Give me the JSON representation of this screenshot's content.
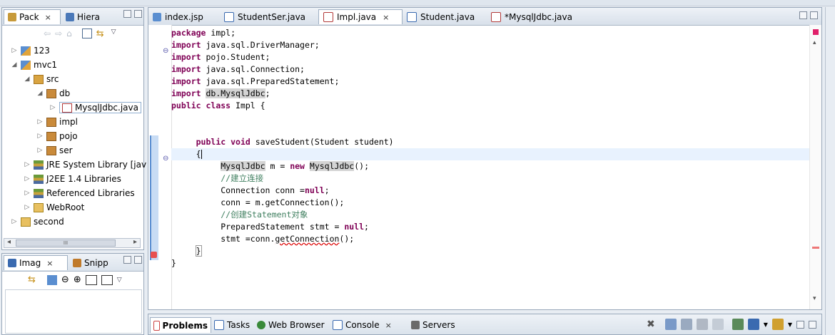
{
  "explorer": {
    "tabs": [
      {
        "label": "Pack",
        "close": "×"
      },
      {
        "label": "Hiera"
      }
    ],
    "tree": [
      {
        "label": "123",
        "twisty": "▷",
        "level": 0
      },
      {
        "label": "mvc1",
        "twisty": "◢",
        "level": 0
      },
      {
        "label": "src",
        "twisty": "◢",
        "level": 1
      },
      {
        "label": "db",
        "twisty": "◢",
        "level": 2
      },
      {
        "label": "MysqlJdbc.java",
        "twisty": "▷",
        "level": 3,
        "selected": true
      },
      {
        "label": "impl",
        "twisty": "▷",
        "level": 2
      },
      {
        "label": "pojo",
        "twisty": "▷",
        "level": 2
      },
      {
        "label": "ser",
        "twisty": "▷",
        "level": 2
      },
      {
        "label": "JRE System Library [jav",
        "twisty": "▷",
        "level": 1
      },
      {
        "label": "J2EE 1.4 Libraries",
        "twisty": "▷",
        "level": 1
      },
      {
        "label": "Referenced Libraries",
        "twisty": "▷",
        "level": 1
      },
      {
        "label": "WebRoot",
        "twisty": "▷",
        "level": 1
      },
      {
        "label": "second",
        "twisty": "▷",
        "level": 0
      }
    ],
    "scroll_label": "III"
  },
  "imag_panel": {
    "tabs": [
      {
        "label": "Imag",
        "close": "×"
      },
      {
        "label": "Snipp"
      }
    ]
  },
  "editor": {
    "tabs": [
      {
        "label": "index.jsp"
      },
      {
        "label": "StudentSer.java"
      },
      {
        "label": "Impl.java",
        "active": true,
        "close": "×"
      },
      {
        "label": "Student.java"
      },
      {
        "label": "*MysqlJdbc.java"
      }
    ]
  },
  "console_panel": {
    "tabs": [
      {
        "label": "Problems",
        "active": true
      },
      {
        "label": "Tasks"
      },
      {
        "label": "Web Browser"
      },
      {
        "label": "Console",
        "close": "×"
      },
      {
        "label": "Servers"
      }
    ]
  },
  "colors": {
    "keyword": "#7f0055",
    "comment": "#3f7f5f",
    "current_line": "#e8f2fe",
    "occurrence_highlight": "#d4d4d4"
  }
}
